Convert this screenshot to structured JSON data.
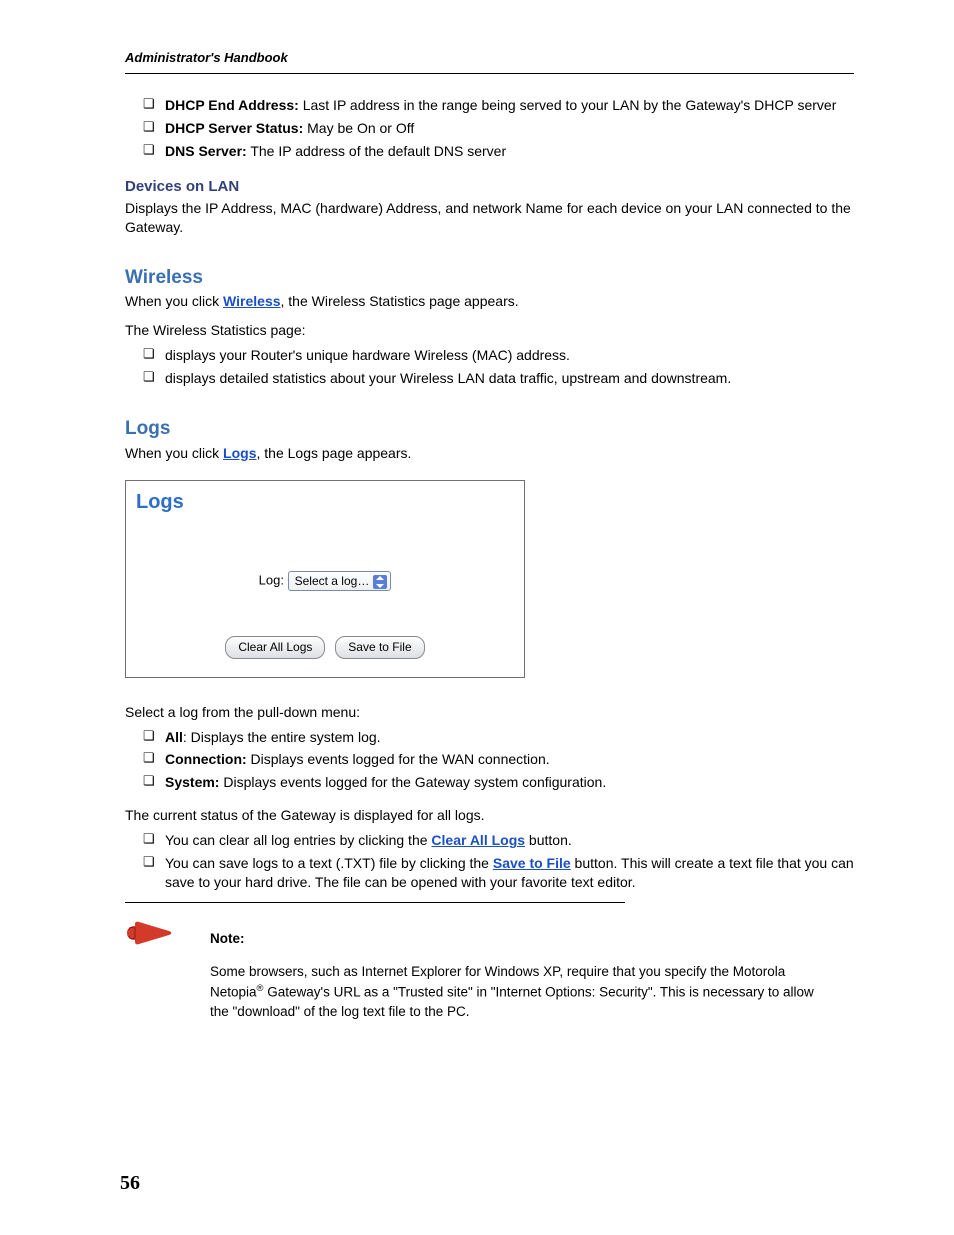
{
  "header": "Administrator's Handbook",
  "top_list": [
    {
      "term": "DHCP End Address:",
      "desc": " Last IP address in the range being served to your LAN by the Gateway's DHCP server"
    },
    {
      "term": "DHCP Server Status:",
      "desc": " May be On or Off"
    },
    {
      "term": "DNS Server:",
      "desc": " The IP address of the default DNS server"
    }
  ],
  "devices": {
    "title": "Devices on LAN",
    "text": "Displays the IP Address, MAC (hardware) Address, and network Name for each device on your LAN connected to the Gateway."
  },
  "wireless": {
    "heading": "Wireless",
    "intro_prefix": "When you click ",
    "intro_link": "Wireless",
    "intro_suffix": ", the Wireless Statistics page appears.",
    "line2": "The Wireless Statistics page:",
    "bullets": [
      "displays your Router's unique hardware Wireless (MAC) address.",
      "displays detailed statistics about your Wireless LAN data traffic, upstream and downstream."
    ]
  },
  "logs": {
    "heading": "Logs",
    "intro_prefix": "When you click ",
    "intro_link": "Logs",
    "intro_suffix": ", the Logs page appears.",
    "panel_title": "Logs",
    "select_label": "Log:",
    "select_value": "Select a log…",
    "btn_clear": "Clear All Logs",
    "btn_save": "Save to File",
    "postline": "Select a log from the pull-down menu:",
    "option_bullets": [
      {
        "term": "All",
        "sep": ": ",
        "desc": "Displays the entire system log."
      },
      {
        "term": "Connection:",
        "sep": " ",
        "desc": "Displays events logged for the WAN connection."
      },
      {
        "term": "System:",
        "sep": " ",
        "desc": "Displays events logged for the Gateway system configuration."
      }
    ],
    "status_line": "The current status of the Gateway is displayed for all logs.",
    "action_bullets": {
      "b1_prefix": "You can clear all log entries by clicking the ",
      "b1_link": "Clear All Logs",
      "b1_suffix": " button.",
      "b2_prefix": "You can save logs to a text (.TXT) file by clicking the ",
      "b2_link": "Save to File",
      "b2_suffix": " button. This will create a text file that you can save to your hard drive. The file can be opened with your favorite text editor."
    }
  },
  "note": {
    "label": "Note:",
    "p1": "Some browsers, such as Internet Explorer for Windows XP, require that you specify the Motorola Netopia",
    "p2": " Gateway's URL as a \"Trusted site\" in \"Internet Options: Security\". This is necessary to allow the \"download\" of the log text file to the PC."
  },
  "page_num": "56"
}
